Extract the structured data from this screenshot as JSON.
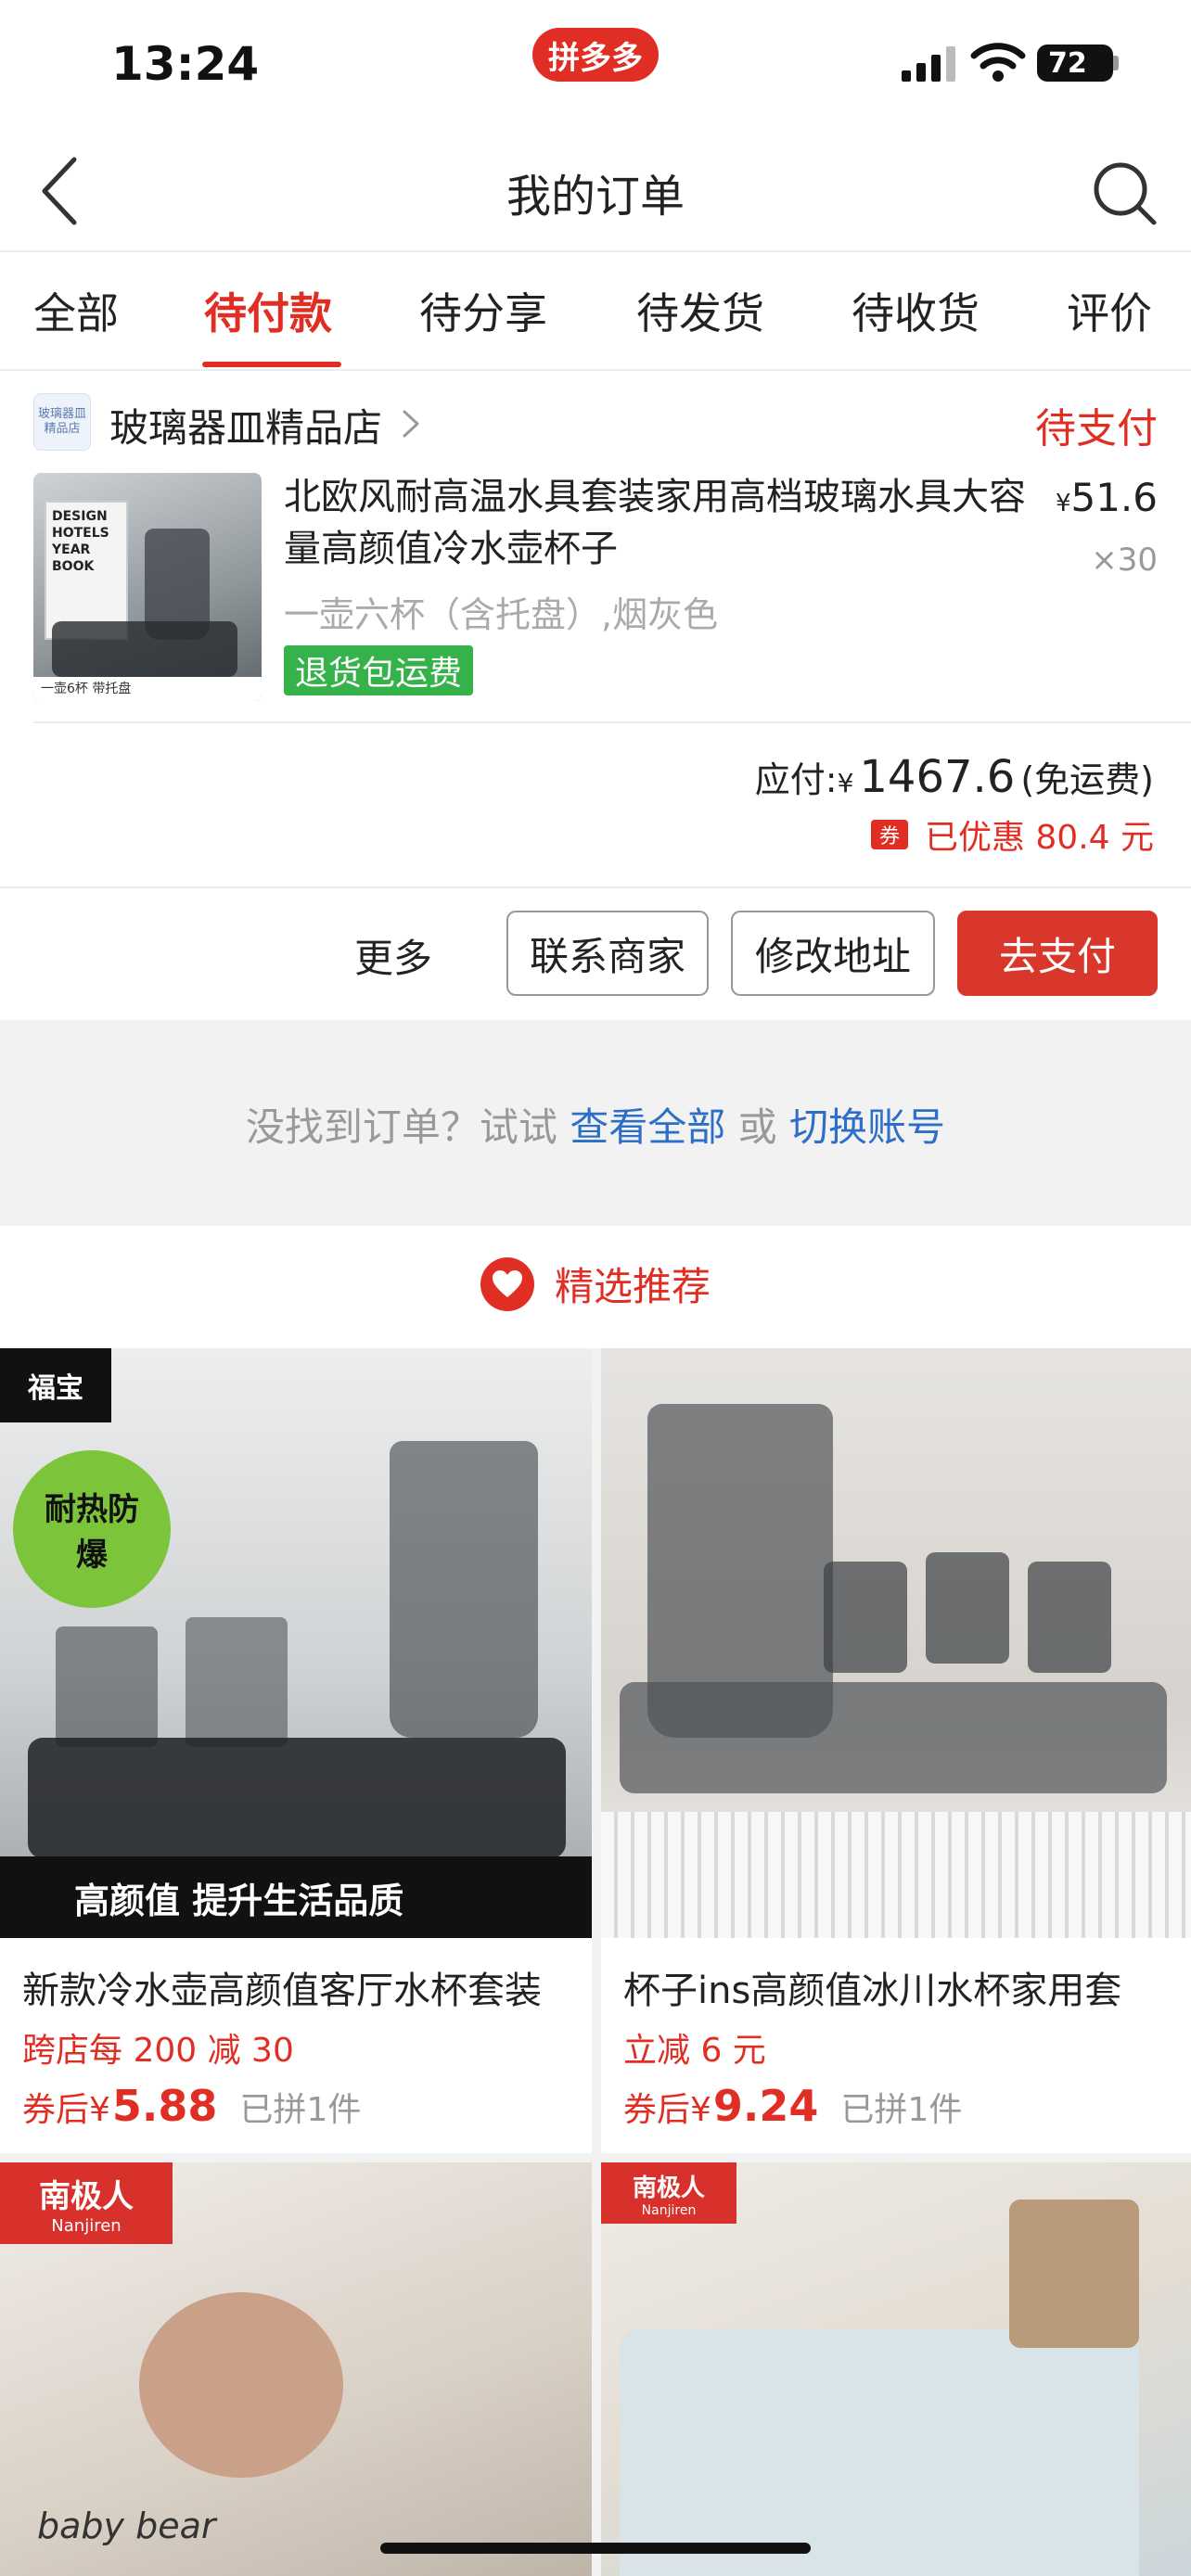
{
  "status_bar": {
    "time": "13:24",
    "app_badge": "拼多多",
    "battery": "72"
  },
  "nav": {
    "title": "我的订单"
  },
  "tabs": [
    {
      "label": "全部"
    },
    {
      "label": "待付款"
    },
    {
      "label": "待分享"
    },
    {
      "label": "待发货"
    },
    {
      "label": "待收货"
    },
    {
      "label": "评价"
    }
  ],
  "order": {
    "shop_logo_text": "玻璃器皿 精品店",
    "shop_name": "玻璃器皿精品店",
    "status": "待支付",
    "product_title": "北欧风耐高温水具套装家用高档玻璃水具大容量高颜值冷水壶杯子",
    "product_image_caption": "DESIGN HOTELS YEAR BOOK",
    "product_image_footer": "一壶6杯 带托盘",
    "currency": "¥",
    "unit_price": "51.6",
    "quantity": "×30",
    "spec": "一壶六杯（含托盘）,烟灰色",
    "tag": "退货包运费",
    "payable_label": "应付:",
    "payable_amount": "1467.6",
    "shipping_note": "(免运费)",
    "coupon_icon": "券",
    "discount_text": "已优惠 80.4 元",
    "actions": {
      "more": "更多",
      "contact": "联系商家",
      "edit_address": "修改地址",
      "pay": "去支付"
    }
  },
  "hint": {
    "prefix": "没找到订单？试试",
    "link_all": "查看全部",
    "or": "或",
    "link_switch": "切换账号"
  },
  "recommend": {
    "title": "精选推荐",
    "items": [
      {
        "title": "新款冷水壶高颜值客厅水杯套装",
        "promo": "跨店每 200 减 30",
        "price_prefix": "券后",
        "currency": "¥",
        "price": "5.88",
        "sold": "已拼1件",
        "brand": "福宝",
        "badge": "耐热防爆",
        "banner": "高颜值 提升生活品质"
      },
      {
        "title": "杯子ins高颜值冰川水杯家用套",
        "promo": "立减 6 元",
        "price_prefix": "券后",
        "currency": "¥",
        "price": "9.24",
        "sold": "已拼1件"
      },
      {
        "brand": "南极人",
        "brand_en": "Nanjiren",
        "caption": "baby bear"
      },
      {
        "brand": "南极人",
        "brand_en": "Nanjiren"
      }
    ]
  },
  "colors": {
    "accent": "#e02e24",
    "link": "#2d6ec7",
    "tag_green": "#36b24a"
  }
}
